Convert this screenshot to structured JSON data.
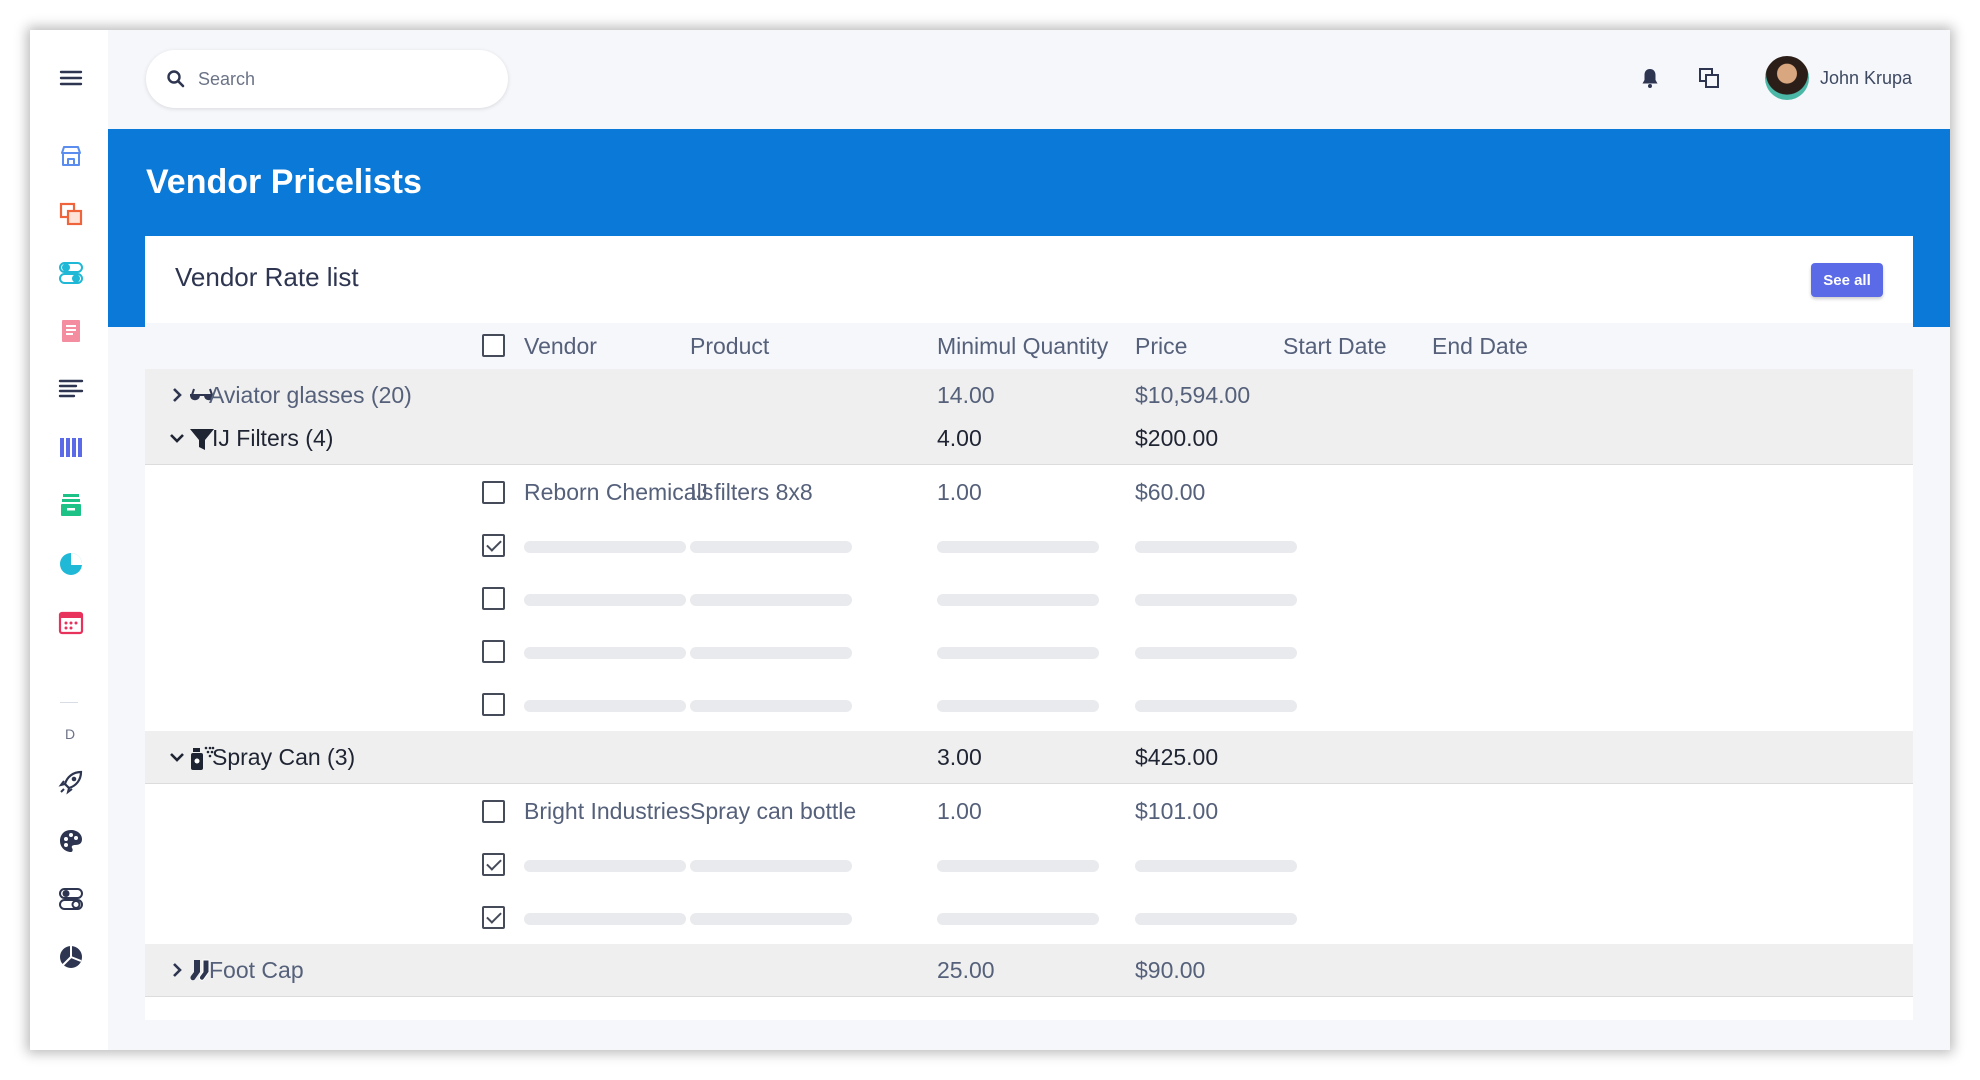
{
  "search": {
    "placeholder": "Search"
  },
  "user": {
    "name": "John Krupa"
  },
  "page": {
    "title": "Vendor Pricelists"
  },
  "sidebar": {
    "section_letter": "D"
  },
  "card": {
    "title": "Vendor Rate list",
    "see_all_label": "See all"
  },
  "columns": {
    "vendor": "Vendor",
    "product": "Product",
    "min_qty": "Minimul Quantity",
    "price": "Price",
    "start_date": "Start Date",
    "end_date": "End Date"
  },
  "groups": [
    {
      "label": "Aviator glasses (20)",
      "min_qty": "14.00",
      "price": "$10,594.00",
      "expanded": false,
      "icon": "glasses-icon"
    },
    {
      "label": "IJ Filters (4)",
      "min_qty": "4.00",
      "price": "$200.00",
      "expanded": true,
      "icon": "filter-icon",
      "rows": [
        {
          "vendor": "Reborn Chemicals",
          "product": "IJ filters 8x8",
          "min_qty": "1.00",
          "price": "$60.00"
        }
      ]
    },
    {
      "label": "Spray Can (3)",
      "min_qty": "3.00",
      "price": "$425.00",
      "expanded": true,
      "icon": "spray-can-icon",
      "rows": [
        {
          "vendor": "Bright Industries",
          "product": "Spray can bottle",
          "min_qty": "1.00",
          "price": "$101.00"
        }
      ]
    },
    {
      "label": "Foot Cap",
      "min_qty": "25.00",
      "price": "$90.00",
      "expanded": false,
      "icon": "socks-icon"
    }
  ],
  "colors": {
    "accent": "#0a79d8",
    "button": "#5b6be8"
  }
}
